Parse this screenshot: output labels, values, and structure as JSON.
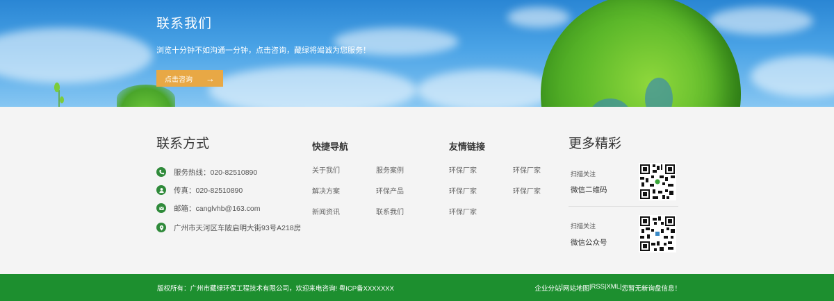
{
  "banner": {
    "title": "联系我们",
    "subtitle": "浏览十分钟不如沟通一分钟，点击咨询，藏绿将竭诚为您服务！",
    "button_label": "点击咨询",
    "button_color": "#e8a845"
  },
  "contact": {
    "title": "联系方式",
    "items": [
      {
        "icon": "phone-icon",
        "text": "服务热线：020-82510890"
      },
      {
        "icon": "user-icon",
        "text": "传真：020-82510890"
      },
      {
        "icon": "mail-icon",
        "text": "邮箱：canglvhb@163.com"
      },
      {
        "icon": "location-icon",
        "text": "广州市天河区车陂启明大街93号A218房"
      }
    ]
  },
  "quick_nav": {
    "title": "快捷导航",
    "links": [
      "关于我们",
      "服务案例",
      "解决方案",
      "环保产品",
      "新闻资讯",
      "联系我们"
    ]
  },
  "friend_links": {
    "title": "友情链接",
    "links": [
      "环保厂家",
      "环保厂家",
      "环保厂家",
      "环保厂家",
      "环保厂家"
    ]
  },
  "more": {
    "title": "更多精彩",
    "qr_items": [
      {
        "caption": "扫描关注",
        "label": "微信二维码"
      },
      {
        "caption": "扫描关注",
        "label": "微信公众号"
      }
    ]
  },
  "footer": {
    "copyright": "版权所有：广州市藏绿环保工程技术有限公司，欢迎来电咨询! 粤ICP备XXXXXXX",
    "links": [
      "企业分站",
      "网站地图",
      "RSS",
      "XML",
      "您暂无新询盘信息！"
    ],
    "separator": " | ",
    "bar_color": "#1d8f2f"
  }
}
